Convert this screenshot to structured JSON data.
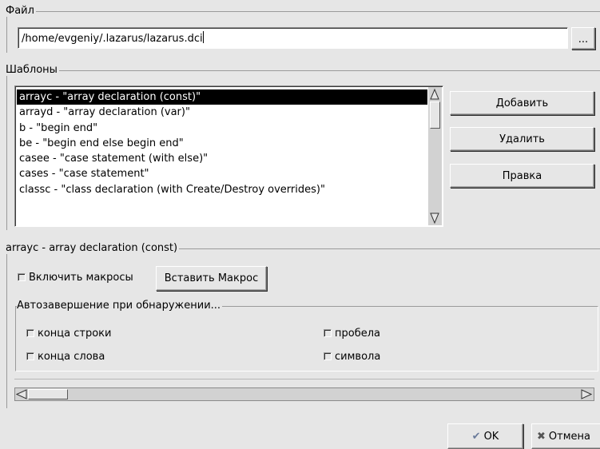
{
  "file_group": {
    "legend": "Файл",
    "path_value": "/home/evgeniy/.lazarus/lazarus.dci",
    "browse_label": "..."
  },
  "templates_group": {
    "legend": "Шаблоны",
    "items": [
      "arrayc - \"array declaration (const)\"",
      "arrayd - \"array declaration (var)\"",
      "b - \"begin end\"",
      "be - \"begin end else begin end\"",
      "casee - \"case statement (with else)\"",
      "cases - \"case statement\"",
      "classc - \"class declaration (with Create/Destroy overrides)\""
    ],
    "selected_index": 0,
    "add_label": "Добавить",
    "delete_label": "Удалить",
    "edit_label": "Правка"
  },
  "editor_group": {
    "legend": "arrayc - array declaration (const)",
    "enable_macros_label": "Включить макросы",
    "insert_macro_label": "Вставить Макрос",
    "autocomplete": {
      "legend": "Автозавершение при обнаружении...",
      "line_end_label": "конца строки",
      "word_end_label": "конца слова",
      "space_label": "пробела",
      "symbol_label": "символа"
    }
  },
  "footer": {
    "ok_label": "OK",
    "cancel_label": "Отмена"
  },
  "colors": {
    "window_bg": "#e6e6e6",
    "selection_bg": "#000000",
    "selection_fg": "#ffffff"
  }
}
